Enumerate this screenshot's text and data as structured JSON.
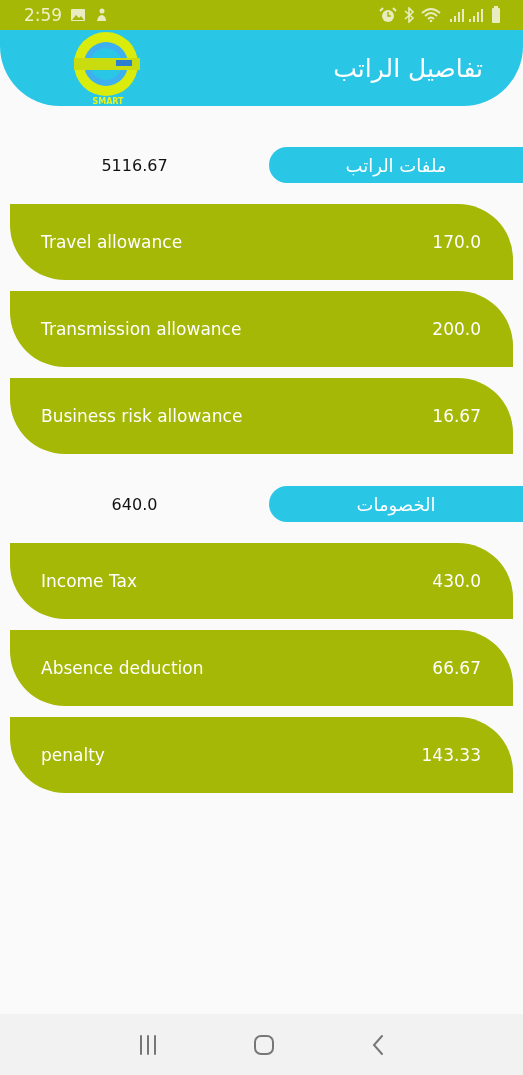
{
  "status_bar": {
    "time": "2:59"
  },
  "header": {
    "title": "تفاصيل الراتب",
    "logo_text": "SMART"
  },
  "sections": [
    {
      "title": "ملفات الراتب",
      "total": "5116.67",
      "items": [
        {
          "label": "Travel allowance",
          "amount": "170.0"
        },
        {
          "label": "Transmission allowance",
          "amount": "200.0"
        },
        {
          "label": "Business risk allowance",
          "amount": "16.67"
        }
      ]
    },
    {
      "title": "الخصومات",
      "total": "640.0",
      "items": [
        {
          "label": "Income Tax",
          "amount": "430.0"
        },
        {
          "label": "Absence deduction",
          "amount": "66.67"
        },
        {
          "label": "penalty",
          "amount": "143.33"
        }
      ]
    }
  ]
}
